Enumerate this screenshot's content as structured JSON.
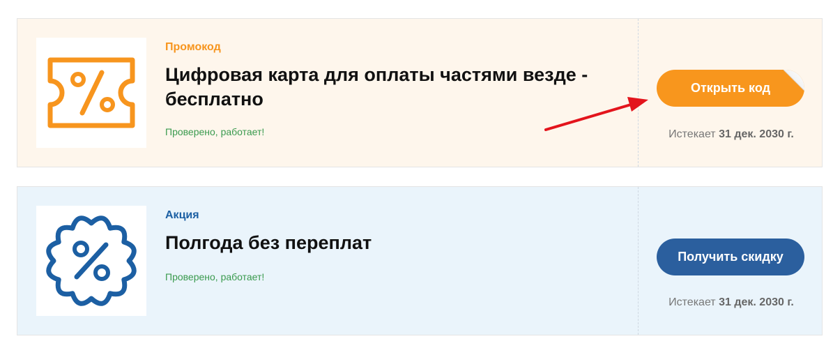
{
  "coupons": [
    {
      "type_label": "Промокод",
      "title": "Цифровая карта для оплаты частями везде - бесплатно",
      "verified": "Проверено, работает!",
      "button_label": "Открыть код",
      "expires_prefix": "Истекает",
      "expires_date": "31 дек. 2030 г.",
      "icon": "percent-ticket-icon",
      "accent_color": "#f7951e"
    },
    {
      "type_label": "Акция",
      "title": "Полгода без переплат",
      "verified": "Проверено, работает!",
      "button_label": "Получить скидку",
      "expires_prefix": "Истекает",
      "expires_date": "31 дек. 2030 г.",
      "icon": "percent-badge-icon",
      "accent_color": "#1c5fa3"
    }
  ]
}
